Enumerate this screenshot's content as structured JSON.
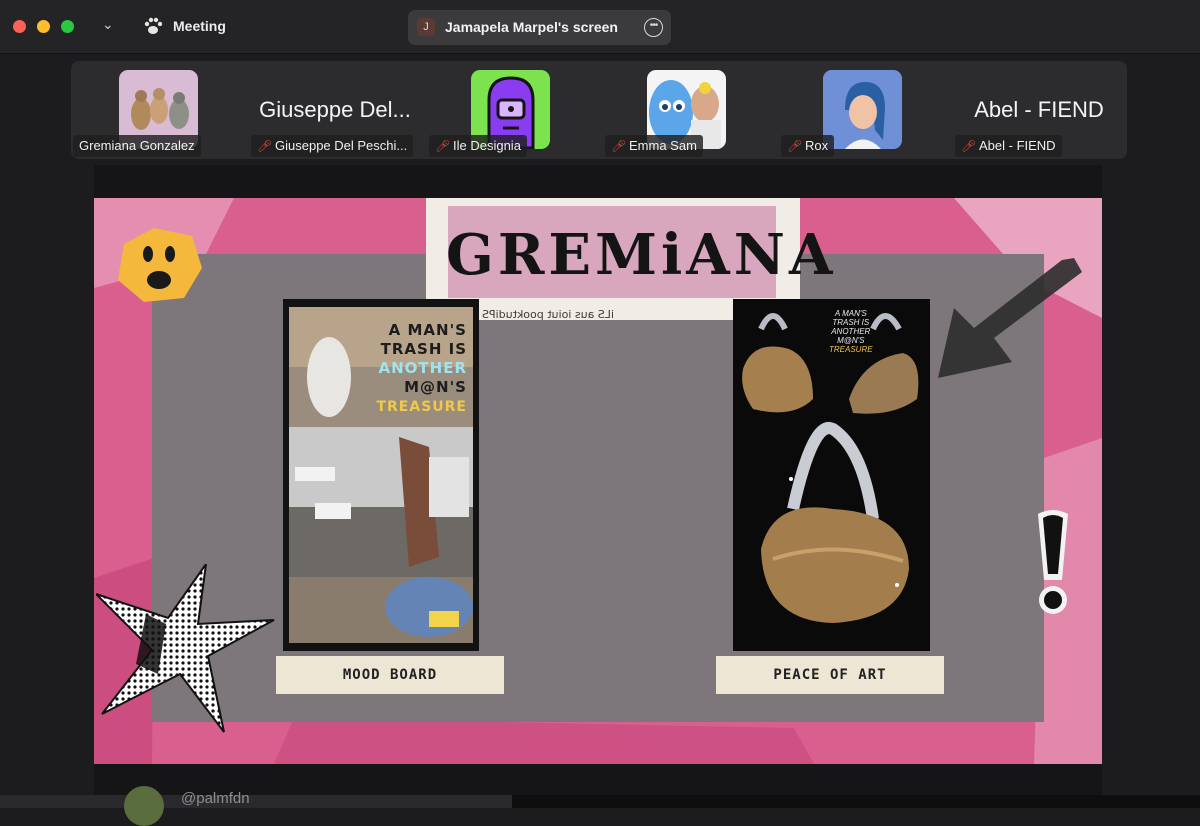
{
  "window": {
    "app_title": "Meeting",
    "sharing_label": "Jamapela Marpel's screen",
    "sharing_initial": "J"
  },
  "participants": [
    {
      "name": "Gremiana Gonzalez",
      "display": "",
      "muted": false
    },
    {
      "name": "Giuseppe Del Peschi...",
      "display": "Giuseppe Del...",
      "muted": true
    },
    {
      "name": "Ile Designia",
      "display": "",
      "muted": true
    },
    {
      "name": "Emma Sam",
      "display": "",
      "muted": true
    },
    {
      "name": "Rox",
      "display": "",
      "muted": true
    },
    {
      "name": "Abel - FIEND",
      "display": "Abel - FIEND",
      "muted": true
    }
  ],
  "slide": {
    "title": "GREMiANA",
    "mirror_text": "iLS aus ioiut pooktudiPS",
    "poster_lines": [
      "A MAN'S",
      "TRASH IS",
      "ANOTHER",
      "M@N'S",
      "TREASURE"
    ],
    "bags_lines": [
      "A MAN'S",
      "TRASH IS",
      "ANOTHER",
      "M@N'S",
      "TREASURE"
    ],
    "left_label": "MOOD BOARD",
    "right_label": "PEACE OF ART"
  },
  "footer": {
    "handle": "@palmfdn"
  },
  "colors": {
    "slide_pink": "#d95f8f",
    "panel_gray": "#7d767b",
    "accent_cyan": "#9fe3f0",
    "accent_yellow": "#f0c84a"
  }
}
